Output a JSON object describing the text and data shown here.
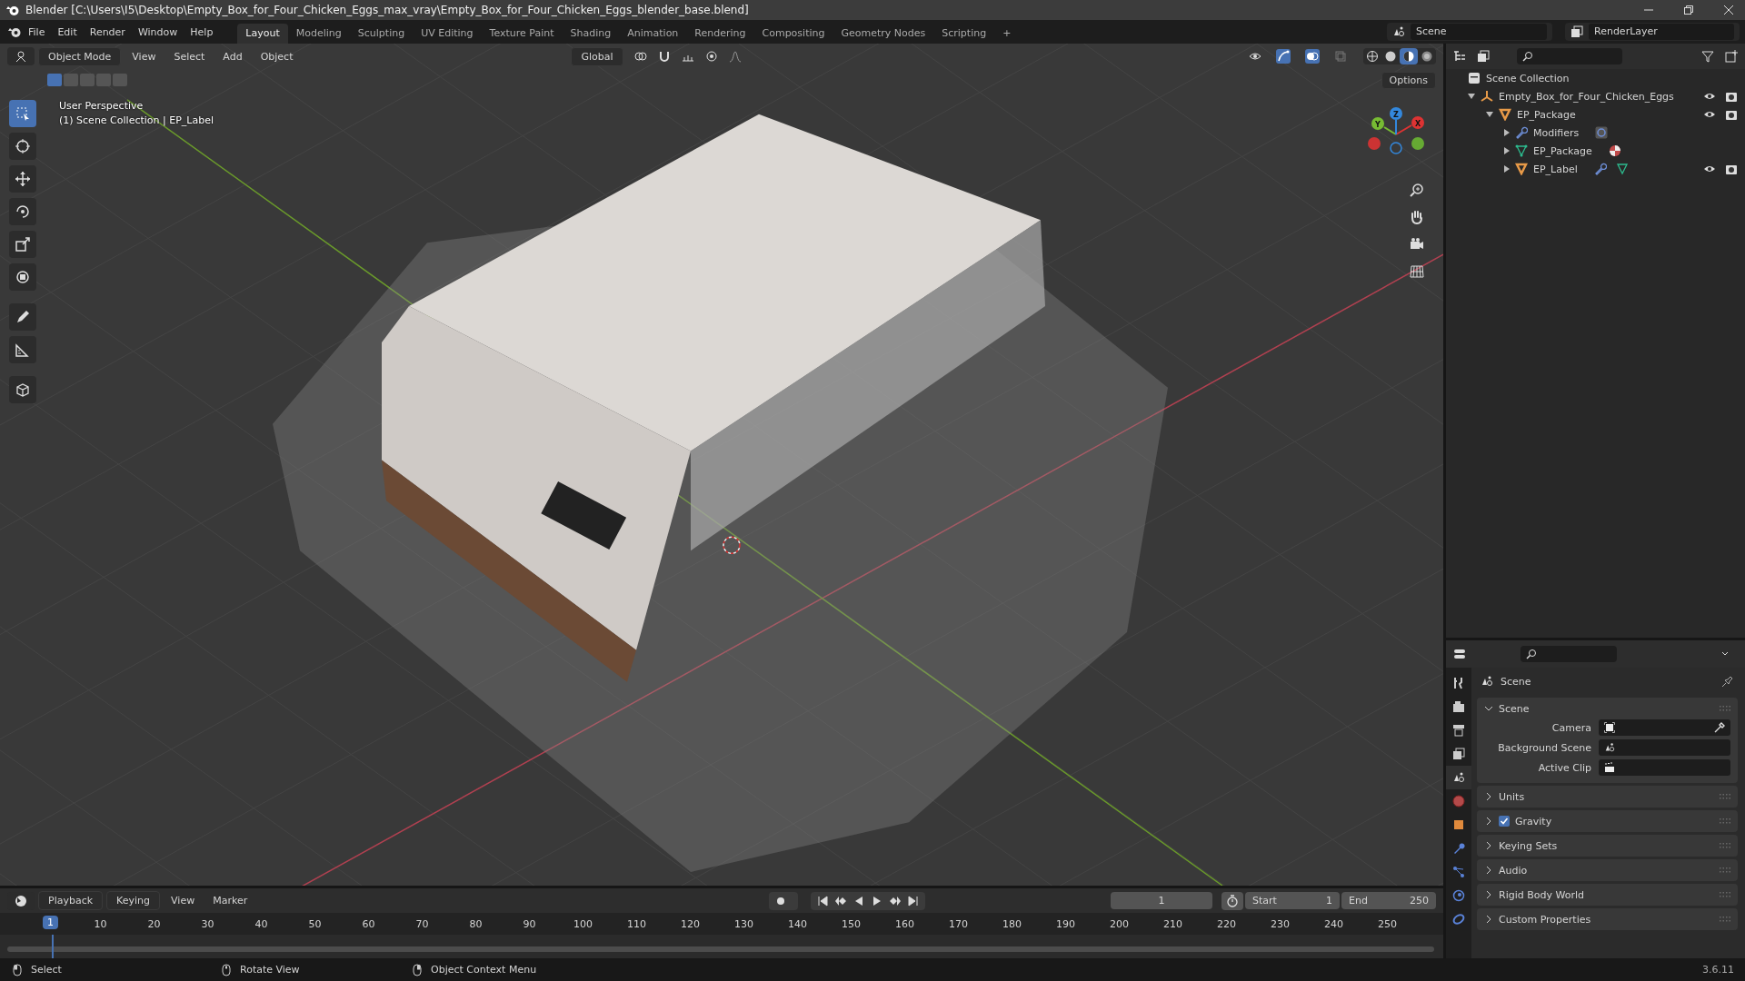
{
  "window": {
    "title": "Blender [C:\\Users\\I5\\Desktop\\Empty_Box_for_Four_Chicken_Eggs_max_vray\\Empty_Box_for_Four_Chicken_Eggs_blender_base.blend]"
  },
  "menu": [
    "File",
    "Edit",
    "Render",
    "Window",
    "Help"
  ],
  "workspace_tabs": [
    {
      "label": "Layout",
      "selected": true
    },
    {
      "label": "Modeling",
      "selected": false
    },
    {
      "label": "Sculpting",
      "selected": false
    },
    {
      "label": "UV Editing",
      "selected": false
    },
    {
      "label": "Texture Paint",
      "selected": false
    },
    {
      "label": "Shading",
      "selected": false
    },
    {
      "label": "Animation",
      "selected": false
    },
    {
      "label": "Rendering",
      "selected": false
    },
    {
      "label": "Compositing",
      "selected": false
    },
    {
      "label": "Geometry Nodes",
      "selected": false
    },
    {
      "label": "Scripting",
      "selected": false
    },
    {
      "label": "+",
      "selected": false
    }
  ],
  "scene": "Scene",
  "view_layer": "RenderLayer",
  "viewport": {
    "mode": "Object Mode",
    "menus": [
      "View",
      "Select",
      "Add",
      "Object"
    ],
    "orientation": "Global",
    "options": "Options",
    "overlay_text": [
      "User Perspective",
      "(1) Scene Collection | EP_Label"
    ],
    "gizmo_axes": [
      "Z",
      "Y",
      "X"
    ],
    "select_modes": [
      {
        "selected": true
      },
      {
        "selected": false
      },
      {
        "selected": false
      },
      {
        "selected": false
      },
      {
        "selected": false
      }
    ],
    "shading": [
      {
        "kind": "wireframe",
        "selected": false
      },
      {
        "kind": "solid",
        "selected": false
      },
      {
        "kind": "material",
        "selected": true
      },
      {
        "kind": "rendered",
        "selected": false
      }
    ],
    "tools": [
      {
        "kind": "select",
        "selected": true
      },
      {
        "kind": "cursor",
        "selected": false
      },
      {
        "kind": "move",
        "selected": false
      },
      {
        "kind": "rotate",
        "selected": false
      },
      {
        "kind": "scale",
        "selected": false
      },
      {
        "kind": "transform",
        "selected": false
      },
      {
        "kind": "annotate",
        "selected": false
      },
      {
        "kind": "measure",
        "selected": false
      },
      {
        "kind": "add_cube",
        "selected": false
      }
    ]
  },
  "outliner": {
    "root": "Scene Collection",
    "items": [
      {
        "label": "Empty_Box_for_Four_Chicken_Eggs",
        "kind": "empty",
        "expanded": true,
        "children": [
          {
            "label": "EP_Package",
            "kind": "mesh_object",
            "expanded": true,
            "children": [
              {
                "label": "Modifiers",
                "kind": "modifiers",
                "expanded": false
              },
              {
                "label": "EP_Package",
                "kind": "mesh_data",
                "expanded": false
              },
              {
                "label": "EP_Label",
                "kind": "mesh_object",
                "expanded": false
              }
            ]
          }
        ]
      }
    ]
  },
  "properties": {
    "tabs": [
      {
        "kind": "tool",
        "selected": false
      },
      {
        "kind": "render",
        "selected": false
      },
      {
        "kind": "output",
        "selected": false
      },
      {
        "kind": "view_layer",
        "selected": false
      },
      {
        "kind": "scene",
        "selected": true
      },
      {
        "kind": "world",
        "selected": false
      },
      {
        "kind": "object",
        "selected": false
      },
      {
        "kind": "modifiers",
        "selected": false
      },
      {
        "kind": "particles",
        "selected": false
      },
      {
        "kind": "physics",
        "selected": false
      },
      {
        "kind": "constraints",
        "selected": false
      }
    ],
    "context": "Scene",
    "panels": [
      {
        "title": "Scene",
        "expanded": true,
        "fields": [
          {
            "label": "Camera",
            "kind": "camera"
          },
          {
            "label": "Background Scene",
            "kind": "scene"
          },
          {
            "label": "Active Clip",
            "kind": "clip"
          }
        ]
      },
      {
        "title": "Units",
        "expanded": false
      },
      {
        "title": "Gravity",
        "expanded": false,
        "checked": true
      },
      {
        "title": "Keying Sets",
        "expanded": false
      },
      {
        "title": "Audio",
        "expanded": false
      },
      {
        "title": "Rigid Body World",
        "expanded": false
      },
      {
        "title": "Custom Properties",
        "expanded": false
      }
    ]
  },
  "timeline": {
    "menus": [
      "Playback",
      "Keying",
      "View",
      "Marker"
    ],
    "current_frame": "1",
    "start_label": "Start",
    "start": "1",
    "end_label": "End",
    "end": "250",
    "ruler": [
      "10",
      "20",
      "30",
      "40",
      "50",
      "60",
      "70",
      "80",
      "90",
      "100",
      "110",
      "120",
      "130",
      "140",
      "150",
      "160",
      "170",
      "180",
      "190",
      "200",
      "210",
      "220",
      "230",
      "240",
      "250"
    ],
    "playhead": "1"
  },
  "status_bar": {
    "hints": [
      {
        "text": "Select",
        "kind": "left"
      },
      {
        "text": "Rotate View",
        "kind": "middle"
      },
      {
        "text": "Object Context Menu",
        "kind": "right"
      }
    ],
    "version": "3.6.11"
  }
}
